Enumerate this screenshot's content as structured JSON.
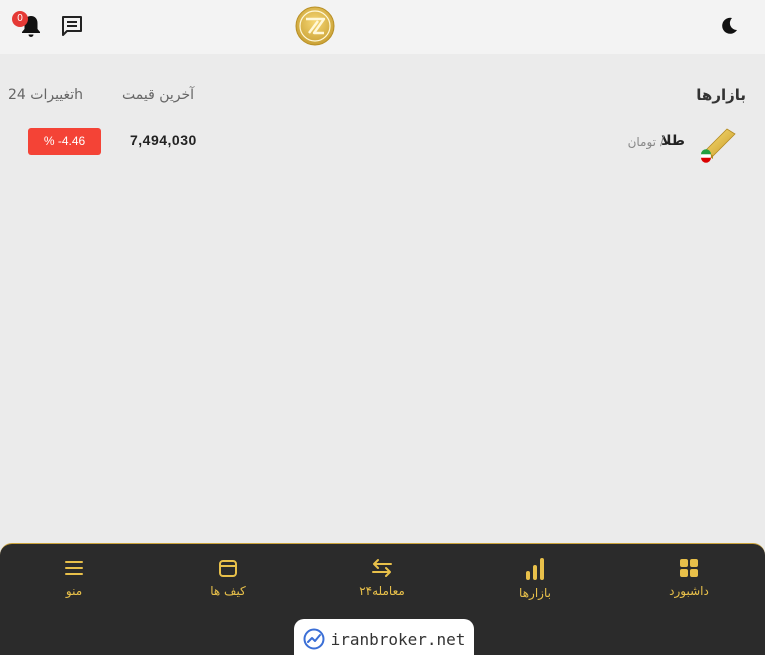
{
  "header": {
    "notification_count": "0",
    "icons": {
      "chat": "chat-icon",
      "bell": "bell-icon",
      "logo": "logo-icon",
      "theme": "moon-icon"
    }
  },
  "markets": {
    "title": "بازارها",
    "columns": {
      "last_price": "آخرین قیمت",
      "change_24h": "تغییرات 24h"
    },
    "rows": [
      {
        "asset": "طلا",
        "separator": "/",
        "quote": "تومان",
        "price": "7,494,030",
        "change": "% -4.46",
        "change_color": "#f44336"
      }
    ]
  },
  "bottom_nav": {
    "items": [
      {
        "label": "داشبورد",
        "icon": "dashboard-icon"
      },
      {
        "label": "بازارها",
        "icon": "bar-chart-icon"
      },
      {
        "label": "معامله۲۴",
        "icon": "swap-icon"
      },
      {
        "label": "کیف ها",
        "icon": "wallet-icon"
      },
      {
        "label": "منو",
        "icon": "menu-icon"
      }
    ],
    "accent_color": "#e8c04a"
  },
  "watermark": {
    "text": "iranbroker.net"
  }
}
